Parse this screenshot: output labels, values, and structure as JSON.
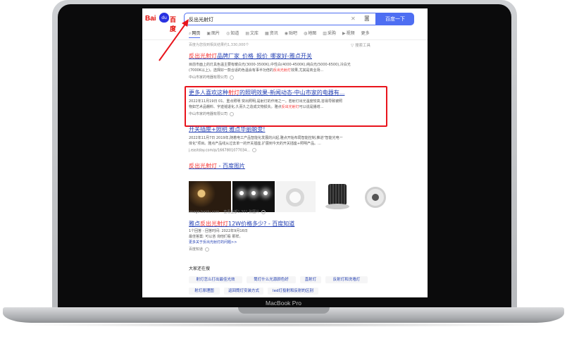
{
  "device": {
    "label": "MacBook Pro"
  },
  "brand": {
    "logo_bai": "Bai",
    "logo_paw": "du",
    "logo_du": "百度"
  },
  "search": {
    "query": "反出光射灯",
    "button": "百度一下"
  },
  "tabs": [
    {
      "icon": "⌕",
      "label": "网页"
    },
    {
      "icon": "▣",
      "label": "图片"
    },
    {
      "icon": "◎",
      "label": "知道"
    },
    {
      "icon": "▤",
      "label": "文库"
    },
    {
      "icon": "▦",
      "label": "资讯"
    },
    {
      "icon": "◉",
      "label": "贴吧"
    },
    {
      "icon": "◍",
      "label": "地图"
    },
    {
      "icon": "▥",
      "label": "采购"
    },
    {
      "icon": "▶",
      "label": "视频"
    },
    {
      "icon": "",
      "label": "更多"
    }
  ],
  "meta": {
    "result_count": "百度为您找到相关结果约1,330,000个",
    "tools": "▽ 搜索工具"
  },
  "results": [
    {
      "title_em": "反出光射灯",
      "title_rest": "品牌厂家_价格_报价_哪家好-雅点开关",
      "desc_1": "目前市面上的灯具色温主要有暖白光(3000-3500K),中性白(4000-4500K),纯白光(5000-6500),冷白光",
      "desc_2": "(7000K以上)。选择好一款合适的色温会有事半功倍的",
      "desc_em": "反出光射灯",
      "desc_3": "效果,尤其是商业场...",
      "source": "中山市家的电器有限公司"
    },
    {
      "title_a": "更多人喜欢这种",
      "title_em": "射灯",
      "title_b": "的照明效果-新闻动态-中山市家的电器有...",
      "desc_1": "2022年11月19日 01、重点照明 突出照明,是射灯的作用之一。若射灯出光温度较高,容易导致被照",
      "desc_2": "物如艺术品棚料、字迹褪退化,久而久之造成文物损失。雅点",
      "desc_em": "反出光射灯",
      "desc_3": "可以说是播增...",
      "source": "中山市家的电器有限公司"
    },
    {
      "title": "开关插座+照明 雅点华丽蜕变!",
      "desc_1": "2022年11月7日 2019年,随着电工产品智能化发展的兴起,雅点开始布局智能控制,推进\"智能光电一",
      "desc_2": "体化\"项目。雅点产品线从过去单一的开关插座,扩展到今天的开关插座+照明产品。...",
      "source": "j.eastday.com/p/1667801077034..."
    },
    {
      "title_em": "反出光射灯",
      "title_rest": " - 百度图片",
      "source": "image.baidu.com",
      "more": "查看全部1,301 张图片"
    },
    {
      "title_a": "雅点",
      "title_em": "反出光射灯",
      "title_b": "12W价格多少? - 百度知道",
      "line_1": "1个回答 - 回答时间: 2022年9月16日",
      "line_2": "最佳答案: 可以咨 询他们看 那样。",
      "line_3": "更多关于反出光射灯的问题>>",
      "source": "百度知道"
    }
  ],
  "related": {
    "title": "大家还在搜",
    "items": [
      "射灯怎么打出最佳光效",
      "筒灯什么光源颜色好",
      "直射灯",
      "反射灯和洗墙灯",
      "射灯原理图",
      "返回筒灯安装方式",
      "led灯投射和反射的区别"
    ]
  },
  "colors": {
    "accent": "#4e6ef2",
    "link": "#2440b3",
    "highlight": "#f73131",
    "annotation": "#e8141c"
  }
}
